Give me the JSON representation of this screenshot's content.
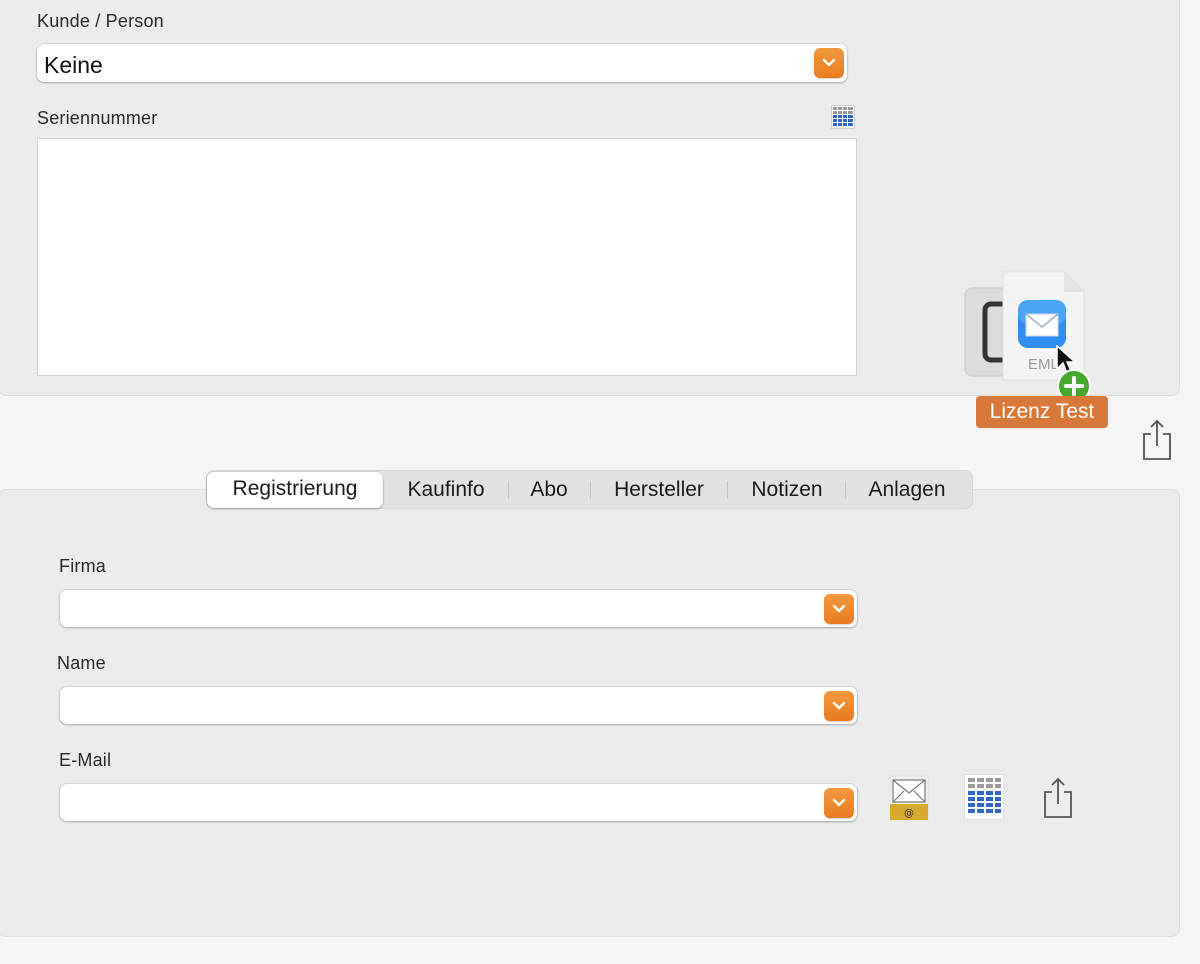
{
  "top": {
    "customer_label": "Kunde / Person",
    "customer_value": "Keine",
    "serial_label": "Seriennummer",
    "serial_value": ""
  },
  "drag": {
    "file_ext": "EML",
    "label": "Lizenz Test"
  },
  "tabs": [
    {
      "label": "Registrierung",
      "active": true
    },
    {
      "label": "Kaufinfo",
      "active": false
    },
    {
      "label": "Abo",
      "active": false
    },
    {
      "label": "Hersteller",
      "active": false
    },
    {
      "label": "Notizen",
      "active": false
    },
    {
      "label": "Anlagen",
      "active": false
    }
  ],
  "form": {
    "firma_label": "Firma",
    "firma_value": "",
    "name_label": "Name",
    "name_value": "",
    "email_label": "E-Mail",
    "email_value": ""
  },
  "colors": {
    "accent_orange": "#e87b20",
    "drag_label_bg": "#d8793a",
    "panel_bg": "#ececec"
  },
  "icons": {
    "combo_button": "chevron-down-icon",
    "grid": "grid-table-icon",
    "share": "share-icon",
    "mail": "mail-at-icon"
  }
}
